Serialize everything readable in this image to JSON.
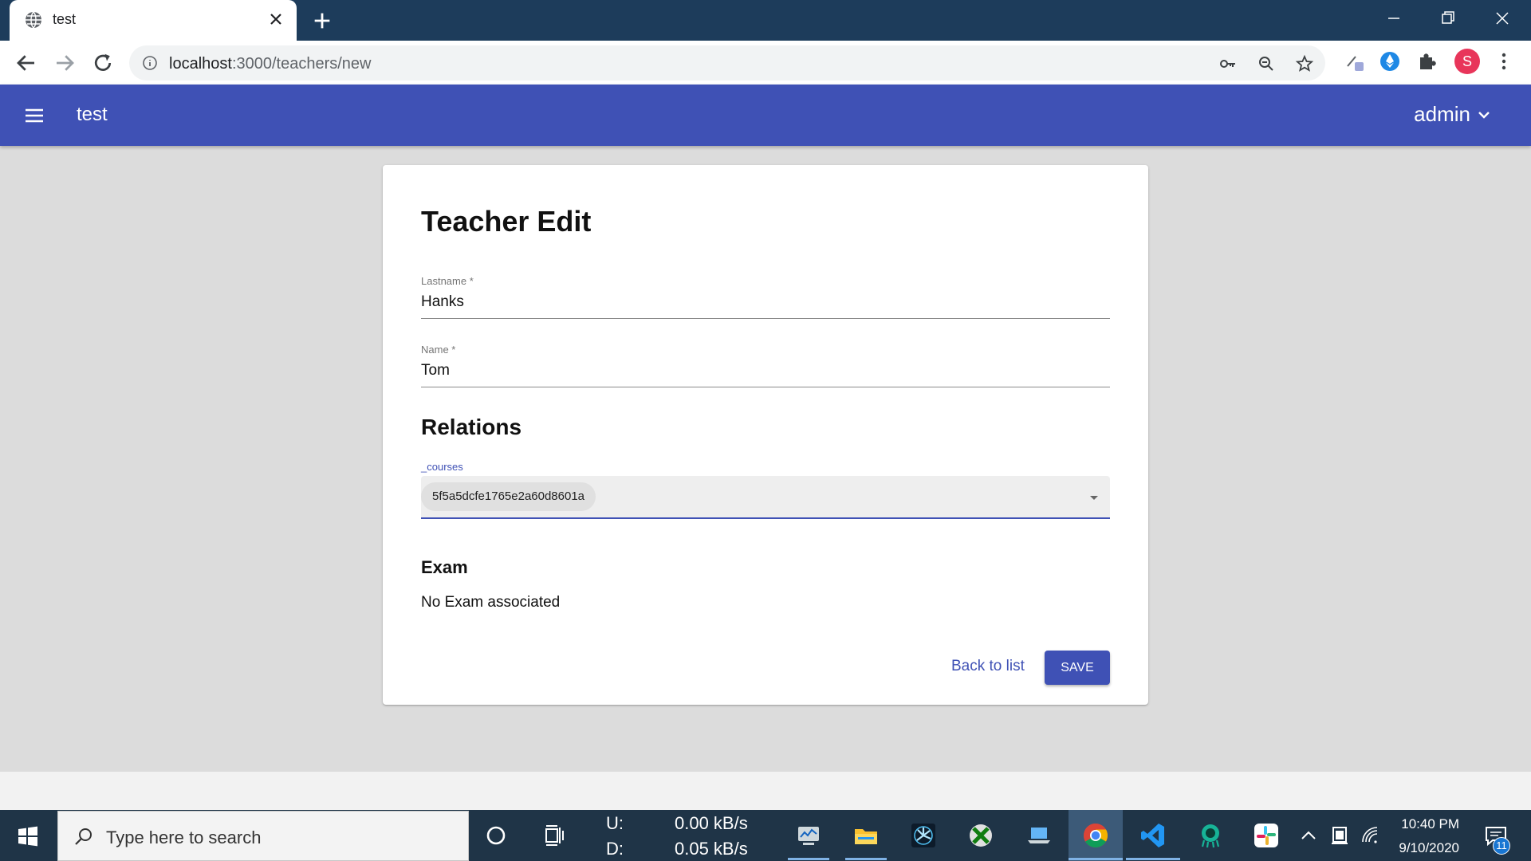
{
  "browser": {
    "tab_title": "test",
    "url_host": "localhost",
    "url_path": ":3000/teachers/new"
  },
  "appbar": {
    "title": "test",
    "user": "admin"
  },
  "form": {
    "title": "Teacher Edit",
    "lastname_label": "Lastname *",
    "lastname_value": "Hanks",
    "name_label": "Name *",
    "name_value": "Tom",
    "relations_heading": "Relations",
    "courses_label": "_courses",
    "courses_chip": "5f5a5dcfe1765e2a60d8601a",
    "exam_heading": "Exam",
    "exam_text": "No Exam associated",
    "back_label": "Back to list",
    "save_label": "SAVE"
  },
  "taskbar": {
    "search_placeholder": "Type here to search",
    "upload_label": "U:",
    "download_label": "D:",
    "upload_rate": "0.00 kB/s",
    "download_rate": "0.05 kB/s",
    "time": "10:40 PM",
    "date": "9/10/2020",
    "notification_count": "11"
  },
  "colors": {
    "appbar": "#3f51b5",
    "accent": "#3f51b5",
    "tabstrip": "#1d3c5b",
    "taskbar": "#1f3447"
  },
  "icons": [
    "globe-icon",
    "close-icon",
    "plus-icon",
    "back-arrow-icon",
    "forward-arrow-icon",
    "reload-icon",
    "info-icon",
    "key-icon",
    "zoom-icon",
    "star-icon",
    "puzzle-icon",
    "menu-icon",
    "chevron-down-icon",
    "dropdown-arrow-icon",
    "windows-icon",
    "search-icon",
    "cortana-icon",
    "task-view-icon",
    "chrome-icon",
    "vscode-icon",
    "slack-icon"
  ]
}
